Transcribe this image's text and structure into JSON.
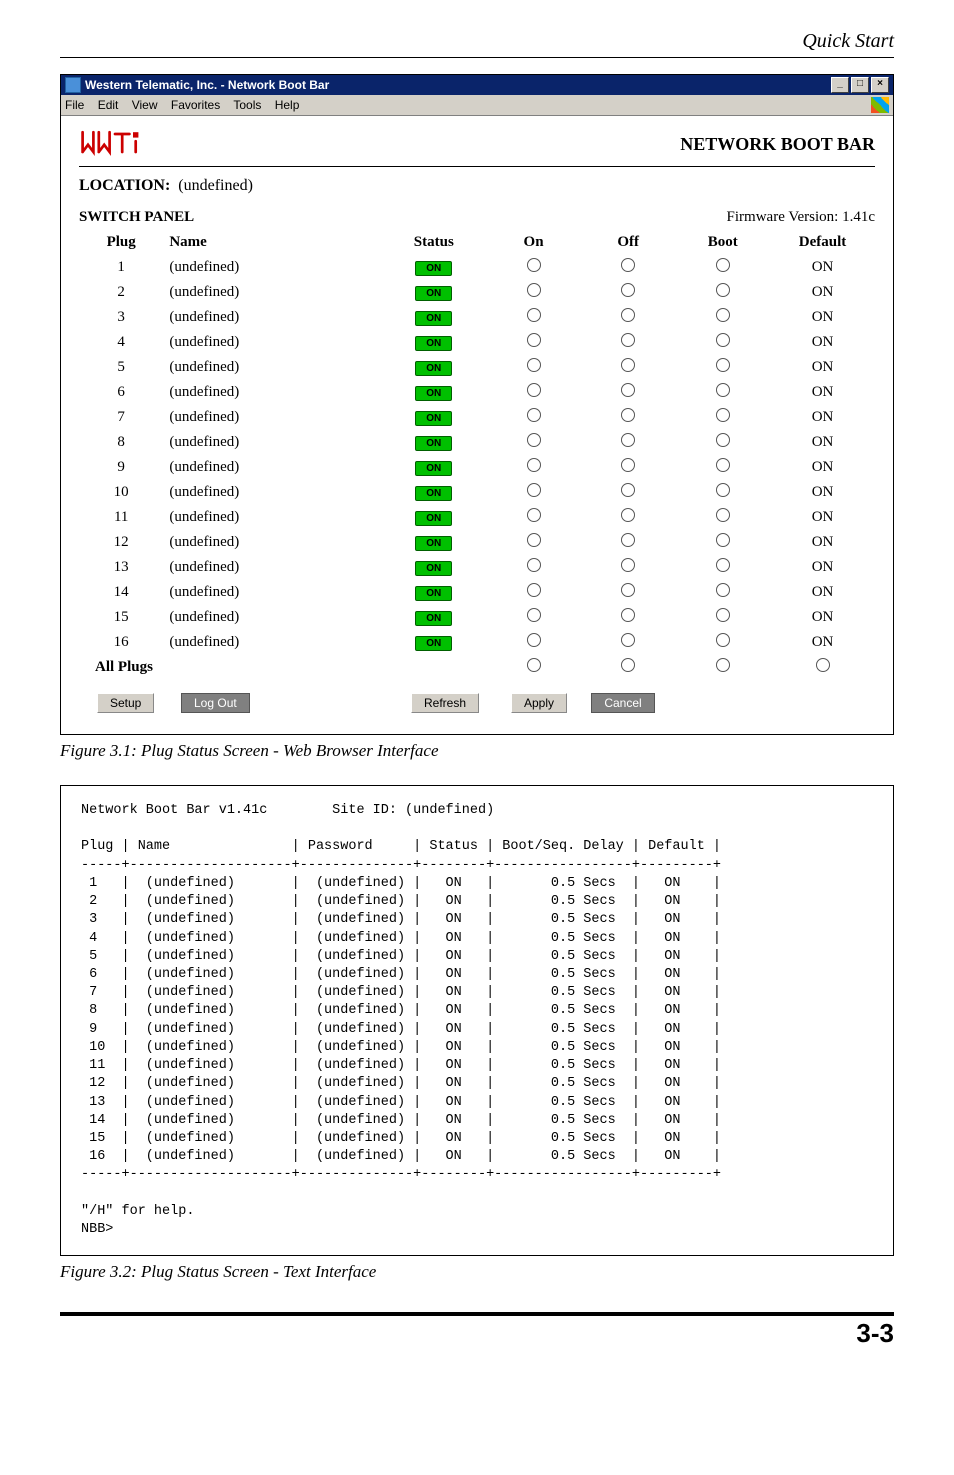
{
  "header": {
    "section": "Quick Start"
  },
  "browser": {
    "title": "Western Telematic, Inc. - Network Boot Bar",
    "menus": [
      "File",
      "Edit",
      "View",
      "Favorites",
      "Tools",
      "Help"
    ],
    "winbtns": {
      "min": "_",
      "max": "□",
      "close": "×"
    }
  },
  "panel": {
    "app_title": "NETWORK BOOT BAR",
    "location_label": "LOCATION:",
    "location_value": "(undefined)",
    "switch_panel_label": "SWITCH PANEL",
    "firmware_label": "Firmware Version: 1.41c",
    "cols": {
      "plug": "Plug",
      "name": "Name",
      "status": "Status",
      "on": "On",
      "off": "Off",
      "boot": "Boot",
      "default": "Default"
    },
    "status_badge": "ON",
    "default_val": "ON",
    "rows": [
      {
        "plug": "1",
        "name": "(undefined)"
      },
      {
        "plug": "2",
        "name": "(undefined)"
      },
      {
        "plug": "3",
        "name": "(undefined)"
      },
      {
        "plug": "4",
        "name": "(undefined)"
      },
      {
        "plug": "5",
        "name": "(undefined)"
      },
      {
        "plug": "6",
        "name": "(undefined)"
      },
      {
        "plug": "7",
        "name": "(undefined)"
      },
      {
        "plug": "8",
        "name": "(undefined)"
      },
      {
        "plug": "9",
        "name": "(undefined)"
      },
      {
        "plug": "10",
        "name": "(undefined)"
      },
      {
        "plug": "11",
        "name": "(undefined)"
      },
      {
        "plug": "12",
        "name": "(undefined)"
      },
      {
        "plug": "13",
        "name": "(undefined)"
      },
      {
        "plug": "14",
        "name": "(undefined)"
      },
      {
        "plug": "15",
        "name": "(undefined)"
      },
      {
        "plug": "16",
        "name": "(undefined)"
      }
    ],
    "all_plugs": "All Plugs",
    "buttons": {
      "setup": "Setup",
      "logout": "Log Out",
      "refresh": "Refresh",
      "apply": "Apply",
      "cancel": "Cancel"
    }
  },
  "figcap1": "Figure 3.1:  Plug Status Screen - Web Browser Interface",
  "text_if": {
    "header": "Network Boot Bar v1.41c        Site ID: (undefined)",
    "cols": "Plug | Name               | Password     | Status | Boot/Seq. Delay | Default |",
    "sep1": "-----+--------------------+--------------+--------+-----------------+---------+",
    "rows": [
      " 1   |  (undefined)       |  (undefined) |   ON   |       0.5 Secs  |   ON    |",
      " 2   |  (undefined)       |  (undefined) |   ON   |       0.5 Secs  |   ON    |",
      " 3   |  (undefined)       |  (undefined) |   ON   |       0.5 Secs  |   ON    |",
      " 4   |  (undefined)       |  (undefined) |   ON   |       0.5 Secs  |   ON    |",
      " 5   |  (undefined)       |  (undefined) |   ON   |       0.5 Secs  |   ON    |",
      " 6   |  (undefined)       |  (undefined) |   ON   |       0.5 Secs  |   ON    |",
      " 7   |  (undefined)       |  (undefined) |   ON   |       0.5 Secs  |   ON    |",
      " 8   |  (undefined)       |  (undefined) |   ON   |       0.5 Secs  |   ON    |",
      " 9   |  (undefined)       |  (undefined) |   ON   |       0.5 Secs  |   ON    |",
      " 10  |  (undefined)       |  (undefined) |   ON   |       0.5 Secs  |   ON    |",
      " 11  |  (undefined)       |  (undefined) |   ON   |       0.5 Secs  |   ON    |",
      " 12  |  (undefined)       |  (undefined) |   ON   |       0.5 Secs  |   ON    |",
      " 13  |  (undefined)       |  (undefined) |   ON   |       0.5 Secs  |   ON    |",
      " 14  |  (undefined)       |  (undefined) |   ON   |       0.5 Secs  |   ON    |",
      " 15  |  (undefined)       |  (undefined) |   ON   |       0.5 Secs  |   ON    |",
      " 16  |  (undefined)       |  (undefined) |   ON   |       0.5 Secs  |   ON    |"
    ],
    "sep2": "-----+--------------------+--------------+--------+-----------------+---------+",
    "help": "\"/H\" for help.",
    "prompt": "NBB>"
  },
  "figcap2": "Figure 3.2:  Plug Status Screen - Text Interface",
  "page_num": "3-3"
}
